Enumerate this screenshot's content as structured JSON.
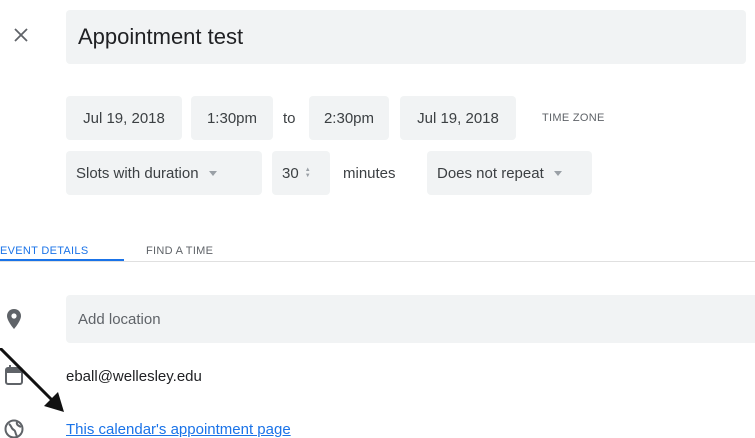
{
  "header": {
    "title_value": "Appointment test"
  },
  "datetime": {
    "start_date": "Jul 19, 2018",
    "start_time": "1:30pm",
    "to_label": "to",
    "end_time": "2:30pm",
    "end_date": "Jul 19, 2018",
    "timezone_label": "TIME ZONE"
  },
  "slots": {
    "type_selected": "Slots with duration",
    "duration_value": "30",
    "duration_unit": "minutes",
    "repeat_selected": "Does not repeat"
  },
  "tabs": [
    {
      "label": "EVENT DETAILS",
      "active": true
    },
    {
      "label": "FIND A TIME",
      "active": false
    }
  ],
  "details": {
    "location_placeholder": "Add location",
    "calendar_owner": "eball@wellesley.edu",
    "appointment_link": "This calendar's appointment page"
  },
  "icons": {
    "close": "close-icon",
    "location": "location-pin-icon",
    "calendar": "calendar-icon",
    "visibility": "globe-icon",
    "annotation": "arrow-annotation"
  },
  "colors": {
    "accent": "#1a73e8",
    "field_bg": "#f1f3f4",
    "icon_gray": "#5f6368"
  }
}
